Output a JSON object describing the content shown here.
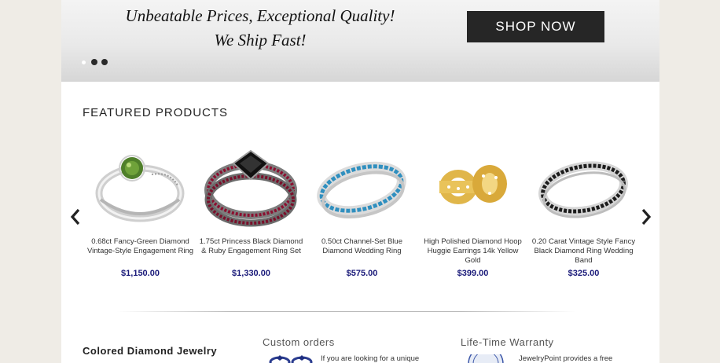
{
  "banner": {
    "tagline_line1": "Unbeatable Prices, Exceptional Quality!",
    "tagline_line2": "We Ship Fast!",
    "cta_label": "SHOP NOW",
    "slides": 3,
    "active_slide": 1
  },
  "featured": {
    "title": "FEATURED PRODUCTS",
    "products": [
      {
        "name": "0.68ct Fancy-Green Diamond Vintage-Style Engagement Ring",
        "price": "$1,150.00",
        "image_icon": "green-diamond-ring-icon"
      },
      {
        "name": "1.75ct Princess Black Diamond & Ruby Engagement Ring Set",
        "price": "$1,330.00",
        "image_icon": "black-diamond-ruby-ring-set-icon"
      },
      {
        "name": "0.50ct Channel-Set Blue Diamond Wedding Ring",
        "price": "$575.00",
        "image_icon": "blue-diamond-band-icon"
      },
      {
        "name": "High Polished Diamond Hoop Huggie Earrings 14k Yellow Gold",
        "price": "$399.00",
        "image_icon": "gold-hoop-earrings-icon"
      },
      {
        "name": "0.20 Carat Vintage Style Fancy Black Diamond Ring Wedding Band",
        "price": "$325.00",
        "image_icon": "black-diamond-band-icon"
      }
    ]
  },
  "sections": {
    "colored_title": "Colored Diamond Jewelry",
    "custom_title": "Custom orders",
    "custom_text": "If you are looking for a unique",
    "warranty_title": "Life-Time Warranty",
    "warranty_text": "JewelryPoint provides a free"
  },
  "colors": {
    "page_background": "#efece6",
    "button_dark": "#262626",
    "price_blue": "#1b1b7a"
  }
}
